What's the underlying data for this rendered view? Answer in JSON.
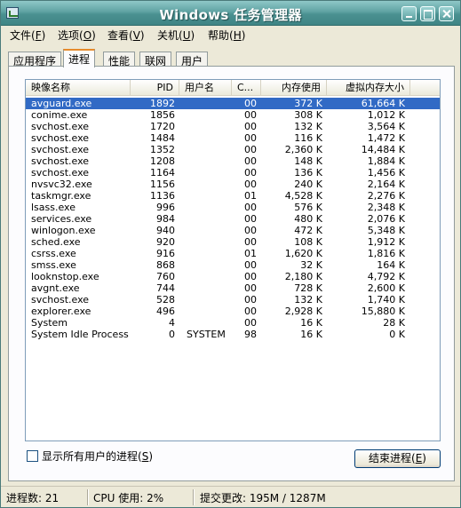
{
  "window": {
    "title": "Windows 任务管理器"
  },
  "menu": [
    {
      "label": "文件(",
      "acc": "F",
      "tail": ")"
    },
    {
      "label": "选项(",
      "acc": "O",
      "tail": ")"
    },
    {
      "label": "查看(",
      "acc": "V",
      "tail": ")"
    },
    {
      "label": "关机(",
      "acc": "U",
      "tail": ")"
    },
    {
      "label": "帮助(",
      "acc": "H",
      "tail": ")"
    }
  ],
  "tabs": [
    "应用程序",
    "进程",
    "性能",
    "联网",
    "用户"
  ],
  "columns": {
    "name": "映像名称",
    "pid": "PID",
    "user": "用户名",
    "cpu": "C...",
    "mem": "内存使用",
    "vm": "虚拟内存大小"
  },
  "processes": [
    {
      "name": "avguard.exe",
      "pid": "1892",
      "user": "",
      "cpu": "00",
      "mem": "372 K",
      "vm": "61,664 K"
    },
    {
      "name": "conime.exe",
      "pid": "1856",
      "user": "",
      "cpu": "00",
      "mem": "308 K",
      "vm": "1,012 K"
    },
    {
      "name": "svchost.exe",
      "pid": "1720",
      "user": "",
      "cpu": "00",
      "mem": "132 K",
      "vm": "3,564 K"
    },
    {
      "name": "svchost.exe",
      "pid": "1484",
      "user": "",
      "cpu": "00",
      "mem": "116 K",
      "vm": "1,472 K"
    },
    {
      "name": "svchost.exe",
      "pid": "1352",
      "user": "",
      "cpu": "00",
      "mem": "2,360 K",
      "vm": "14,484 K"
    },
    {
      "name": "svchost.exe",
      "pid": "1208",
      "user": "",
      "cpu": "00",
      "mem": "148 K",
      "vm": "1,884 K"
    },
    {
      "name": "svchost.exe",
      "pid": "1164",
      "user": "",
      "cpu": "00",
      "mem": "136 K",
      "vm": "1,456 K"
    },
    {
      "name": "nvsvc32.exe",
      "pid": "1156",
      "user": "",
      "cpu": "00",
      "mem": "240 K",
      "vm": "2,164 K"
    },
    {
      "name": "taskmgr.exe",
      "pid": "1136",
      "user": "",
      "cpu": "01",
      "mem": "4,528 K",
      "vm": "2,276 K"
    },
    {
      "name": "lsass.exe",
      "pid": "996",
      "user": "",
      "cpu": "00",
      "mem": "576 K",
      "vm": "2,348 K"
    },
    {
      "name": "services.exe",
      "pid": "984",
      "user": "",
      "cpu": "00",
      "mem": "480 K",
      "vm": "2,076 K"
    },
    {
      "name": "winlogon.exe",
      "pid": "940",
      "user": "",
      "cpu": "00",
      "mem": "472 K",
      "vm": "5,348 K"
    },
    {
      "name": "sched.exe",
      "pid": "920",
      "user": "",
      "cpu": "00",
      "mem": "108 K",
      "vm": "1,912 K"
    },
    {
      "name": "csrss.exe",
      "pid": "916",
      "user": "",
      "cpu": "01",
      "mem": "1,620 K",
      "vm": "1,816 K"
    },
    {
      "name": "smss.exe",
      "pid": "868",
      "user": "",
      "cpu": "00",
      "mem": "32 K",
      "vm": "164 K"
    },
    {
      "name": "looknstop.exe",
      "pid": "760",
      "user": "",
      "cpu": "00",
      "mem": "2,180 K",
      "vm": "4,792 K"
    },
    {
      "name": "avgnt.exe",
      "pid": "744",
      "user": "",
      "cpu": "00",
      "mem": "728 K",
      "vm": "2,600 K"
    },
    {
      "name": "svchost.exe",
      "pid": "528",
      "user": "",
      "cpu": "00",
      "mem": "132 K",
      "vm": "1,740 K"
    },
    {
      "name": "explorer.exe",
      "pid": "496",
      "user": "",
      "cpu": "00",
      "mem": "2,928 K",
      "vm": "15,880 K"
    },
    {
      "name": "System",
      "pid": "4",
      "user": "",
      "cpu": "00",
      "mem": "16 K",
      "vm": "28 K"
    },
    {
      "name": "System Idle Process",
      "pid": "0",
      "user": "SYSTEM",
      "cpu": "98",
      "mem": "16 K",
      "vm": "0 K"
    }
  ],
  "selected_row": 0,
  "show_all_users": {
    "label": "显示所有用户的进程(",
    "acc": "S",
    "tail": ")",
    "checked": false
  },
  "end_process": {
    "label": "结束进程(",
    "acc": "E",
    "tail": ")"
  },
  "status": {
    "processes": "进程数: 21",
    "cpu": "CPU 使用: 2%",
    "commit": "提交更改: 195M / 1287M"
  }
}
